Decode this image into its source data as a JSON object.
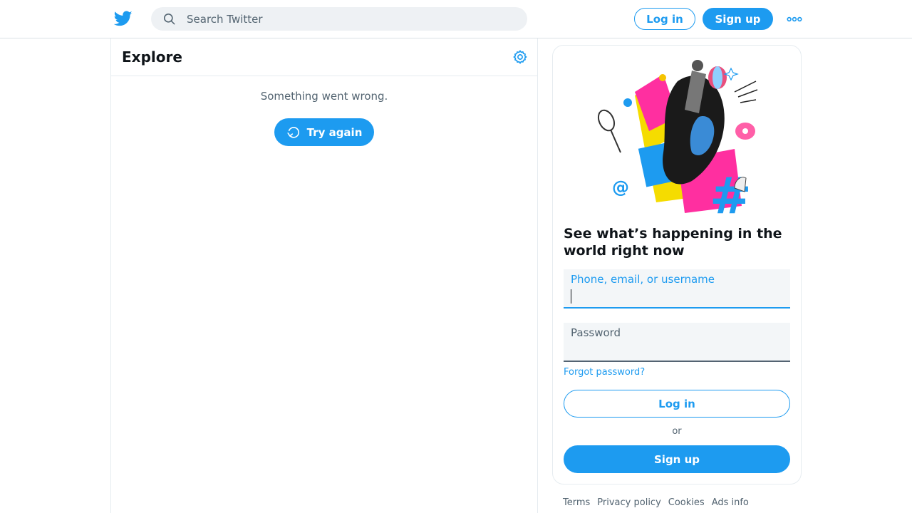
{
  "header": {
    "logo_icon": "twitter-bird-icon",
    "search": {
      "placeholder": "Search Twitter",
      "value": "",
      "icon": "search-icon"
    },
    "login_label": "Log in",
    "signup_label": "Sign up",
    "more_icon": "more-horizontal-icon"
  },
  "main": {
    "title": "Explore",
    "settings_icon": "gear-icon",
    "error_message": "Something went wrong.",
    "retry_label": "Try again",
    "retry_icon": "refresh-icon"
  },
  "sidebar": {
    "illustration": "collage-illustration",
    "headline": "See what’s happening in the world right now",
    "username_field": {
      "label": "Phone, email, or username",
      "value": ""
    },
    "password_field": {
      "label": "Password",
      "value": ""
    },
    "forgot_password": "Forgot password?",
    "login_label": "Log in",
    "or_text": "or",
    "signup_label": "Sign up"
  },
  "footer": {
    "links": [
      "Terms",
      "Privacy policy",
      "Cookies",
      "Ads info"
    ]
  },
  "colors": {
    "accent": "#1d9bf0",
    "text_primary": "#0f1419",
    "text_secondary": "#536471",
    "border": "#e6ecf0",
    "search_bg": "#eef1f4"
  }
}
